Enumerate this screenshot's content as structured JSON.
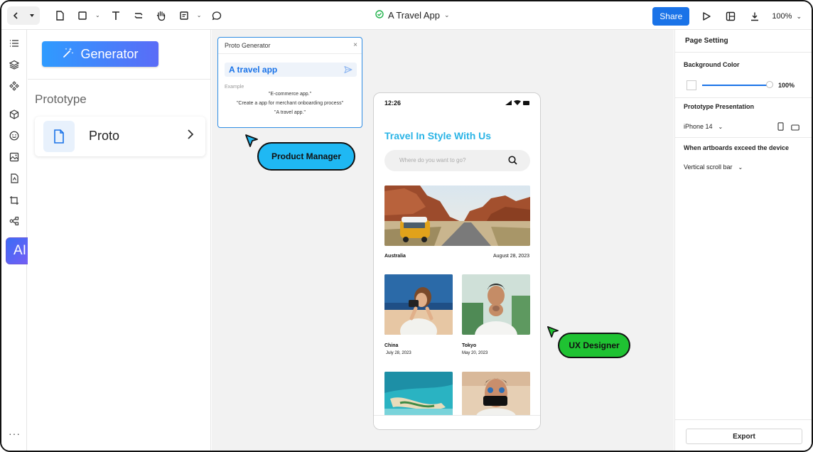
{
  "topbar": {
    "title": "A Travel App",
    "share_label": "Share",
    "zoom": "100%"
  },
  "sidebar": {
    "ai_label": "AI",
    "more": "···"
  },
  "left_panel": {
    "generator_label": "Generator",
    "section_title": "Prototype",
    "card_label": "Proto"
  },
  "proto_generator": {
    "title": "Proto Generator",
    "close": "×",
    "input_value": "A travel app",
    "example_label": "Example",
    "examples": [
      "\"E-commerce app.\"",
      "\"Create a app for merchant onboarding process\"",
      "\"A travel app.\""
    ]
  },
  "collaborators": {
    "product_manager": "Product Manager",
    "ux_designer": "UX Designer",
    "pm_color": "#1fb8f3",
    "ux_color": "#1fc232"
  },
  "phone": {
    "time": "12:26",
    "heading": "Travel In Style With Us",
    "search_placeholder": "Where do you want to go?",
    "featured": {
      "place": "Australia",
      "date": "August 28, 2023"
    },
    "cards": [
      {
        "place": "China",
        "date": "July 28, 2023"
      },
      {
        "place": "Tokyo",
        "date": "May 20, 2023"
      }
    ]
  },
  "right_panel": {
    "title": "Page Setting",
    "background_color_label": "Background Color",
    "opacity": "100%",
    "presentation_label": "Prototype Presentation",
    "device": "iPhone 14",
    "overflow_label": "When artboards exceed the device",
    "overflow_value": "Vertical scroll bar",
    "export_label": "Export"
  },
  "colors": {
    "accent": "#1a73e8",
    "heading_cyan": "#2bb4e6"
  }
}
